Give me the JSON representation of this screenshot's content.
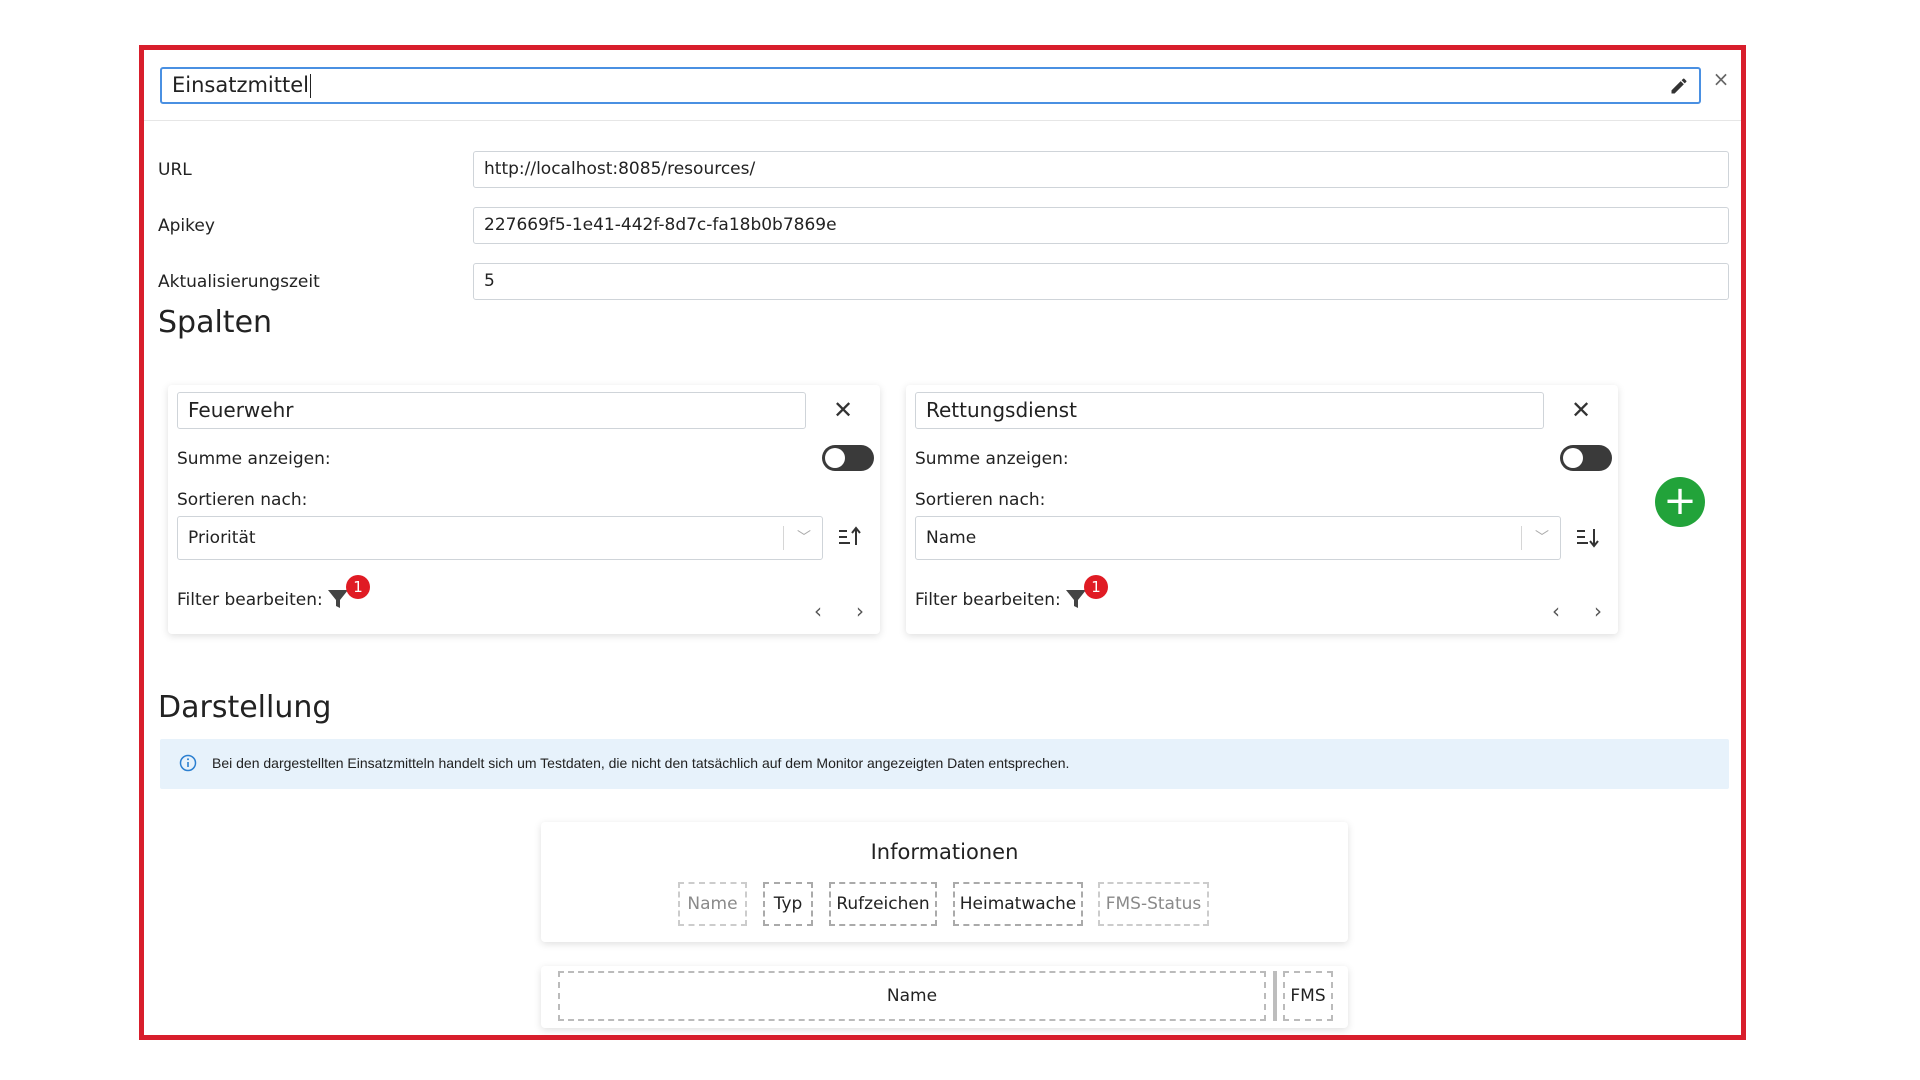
{
  "dialog": {
    "title_value": "Einsatzmittel",
    "close_label": "×"
  },
  "fields": {
    "url": {
      "label": "URL",
      "value": "http://localhost:8085/resources/"
    },
    "apikey": {
      "label": "Apikey",
      "value": "227669f5-1e41-442f-8d7c-fa18b0b7869e"
    },
    "refresh": {
      "label": "Aktualisierungszeit",
      "value": "5"
    }
  },
  "columns_section": {
    "heading": "Spalten",
    "cards": [
      {
        "name": "Feuerwehr",
        "sum_label": "Summe anzeigen:",
        "sum_enabled": false,
        "sort_label": "Sortieren nach:",
        "sort_value": "Priorität",
        "sort_direction": "ascending",
        "filter_label": "Filter bearbeiten:",
        "filter_count": "1",
        "remove_icon": "close-icon",
        "prev": "‹",
        "next": "›"
      },
      {
        "name": "Rettungsdienst",
        "sum_label": "Summe anzeigen:",
        "sum_enabled": false,
        "sort_label": "Sortieren nach:",
        "sort_value": "Name",
        "sort_direction": "descending",
        "filter_label": "Filter bearbeiten:",
        "filter_count": "1",
        "remove_icon": "close-icon",
        "prev": "‹",
        "next": "›"
      }
    ],
    "add_label": "+"
  },
  "display_section": {
    "heading": "Darstellung",
    "info_text": "Bei den dargestellten Einsatzmitteln handelt sich um Testdaten, die nicht den tatsächlich auf dem Monitor angezeigten Daten entsprechen.",
    "info_card": {
      "title": "Informationen",
      "chips": [
        {
          "label": "Name",
          "active": false
        },
        {
          "label": "Typ",
          "active": true
        },
        {
          "label": "Rufzeichen",
          "active": true
        },
        {
          "label": "Heimatwache",
          "active": true
        },
        {
          "label": "FMS-Status",
          "active": false
        }
      ]
    },
    "preview": {
      "col_name": "Name",
      "col_fms": "FMS"
    }
  },
  "colors": {
    "frame": "#d81e2c",
    "accent": "#4a90e2",
    "add_button": "#22a33a",
    "badge": "#e01b24",
    "info_bg": "#e7f2fb"
  }
}
